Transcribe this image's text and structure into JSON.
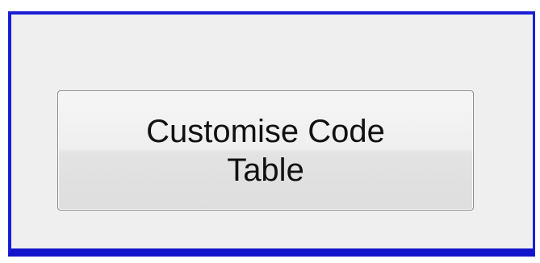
{
  "dialog": {
    "button": {
      "label": "Customise Code Table"
    }
  },
  "colors": {
    "frame_border": "#1a1fd6",
    "panel_background": "#efefef",
    "button_border": "#8c8c8c"
  }
}
